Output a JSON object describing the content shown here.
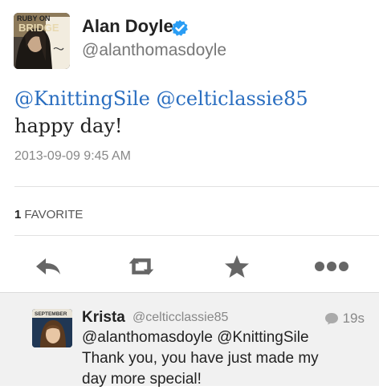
{
  "tweet": {
    "display_name": "Alan Doyle",
    "handle": "@alanthomasdoyle",
    "avatar_text_1": "RUBY ON",
    "avatar_text_2": "BRIDGE",
    "text_mention_1": "@KnittingSile",
    "text_mention_2": "@celticlassie85",
    "text_rest": " happy day!",
    "timestamp": "2013-09-09 9:45 AM",
    "favorite_count": "1",
    "favorite_label": "FAVORITE"
  },
  "actions": {
    "icons": [
      "reply-icon",
      "retweet-icon",
      "favorite-star-icon",
      "more-icon"
    ]
  },
  "reply": {
    "name": "Krista",
    "handle": "@celticclassie85",
    "time": "19s",
    "avatar_label": "SEPTEMBER",
    "line_1": "@alanthomasdoyle @KnittingSile",
    "line_2": "Thank you, you have just made my",
    "line_3": "day more special!"
  },
  "colors": {
    "link": "#2a6ec0",
    "verified": "#2a9df4",
    "icon": "#666666"
  }
}
